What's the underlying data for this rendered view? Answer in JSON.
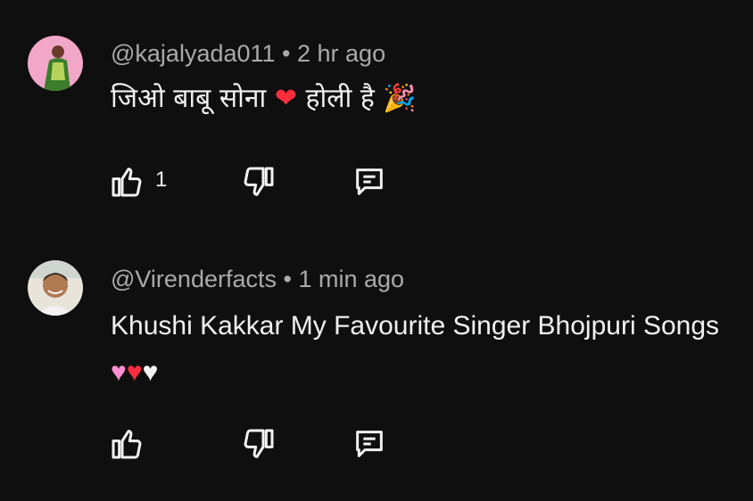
{
  "comments": [
    {
      "handle": "@kajalyada011",
      "separator": "•",
      "time": "2 hr ago",
      "text": "जिओ बाबू सोना ❤️ होली है 🎉",
      "text_parts": {
        "before": "जिओ बाबू सोना ",
        "heart": "❤",
        "middle": " होली है ",
        "party": "🎉"
      },
      "like_count": "1",
      "avatar_colors": {
        "bg": "#f2a7c8",
        "figure": "#3b7d2a"
      }
    },
    {
      "handle": "@Virenderfacts",
      "separator": "•",
      "time": "1 min ago",
      "text": "Khushi Kakkar My Favourite Singer Bhojpuri Songs 🩷❤️🤍",
      "text_parts": {
        "before": "Khushi Kakkar My Favourite Singer Bhojpuri Songs ",
        "pink_heart": "♥",
        "red_heart": "♥",
        "white_heart": "♥"
      },
      "like_count": "",
      "avatar_colors": {
        "bg": "#e9e4da",
        "figure": "#7a5a3c"
      }
    }
  ],
  "icons": {
    "like": "thumbs-up-icon",
    "dislike": "thumbs-down-icon",
    "reply": "reply-comment-icon"
  },
  "colors": {
    "background": "#0f0f0f",
    "meta": "#aaaaaa",
    "text": "#f1f1f1",
    "heart_red": "#ff2d3d",
    "heart_pink": "#ff8fd0"
  }
}
